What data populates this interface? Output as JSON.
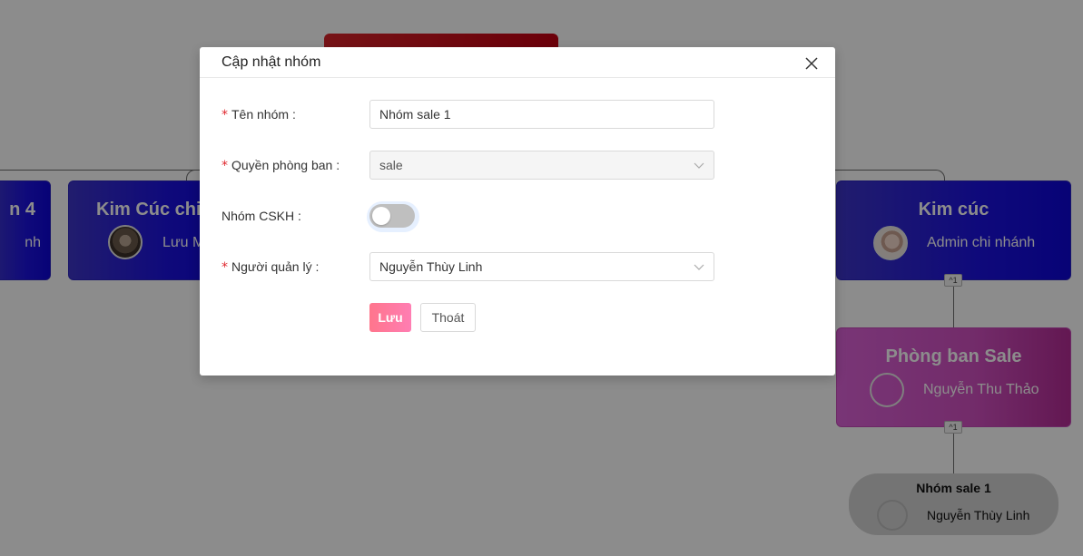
{
  "chart": {
    "nodes": {
      "top_red": {
        "title": ""
      },
      "left_partial": {
        "title": "n 4",
        "role": "nh"
      },
      "kim_cuc_chi": {
        "title": "Kim Cúc chi",
        "role": "Lưu M"
      },
      "kim_cuc": {
        "title": "Kim cúc",
        "role": "Admin chi nhánh"
      },
      "phong_ban_sale": {
        "title": "Phòng ban Sale",
        "role": "Nguyễn Thu Thảo"
      },
      "nhom_sale_1": {
        "title": "Nhóm sale 1",
        "role": "Nguyễn Thùy Linh"
      }
    },
    "badges": {
      "kim_cuc": "^1",
      "phong_ban_sale": "^1"
    },
    "icons": {
      "avatar": "avatar-icon",
      "collapse": "chevron-up-icon"
    }
  },
  "modal": {
    "title": "Cập nhật nhóm",
    "close_icon": "close-icon",
    "fields": {
      "group_name": {
        "label": "Tên nhóm",
        "value": "Nhóm sale 1",
        "required": "*"
      },
      "department": {
        "label": "Quyền phòng ban",
        "value": "sale",
        "required": "*"
      },
      "cskh": {
        "label": "Nhóm CSKH",
        "value": "off"
      },
      "manager": {
        "label": "Người quản lý",
        "value": "Nguyễn Thùy Linh",
        "required": "*"
      }
    },
    "colon": ":",
    "buttons": {
      "save": "Lưu",
      "exit": "Thoát"
    }
  },
  "colors": {
    "node_blue": "#1c12e0",
    "node_pink": "#d04fc0",
    "node_red": "#c40012",
    "save_button": "#ff758c",
    "required_asterisk": "#e0282e"
  }
}
